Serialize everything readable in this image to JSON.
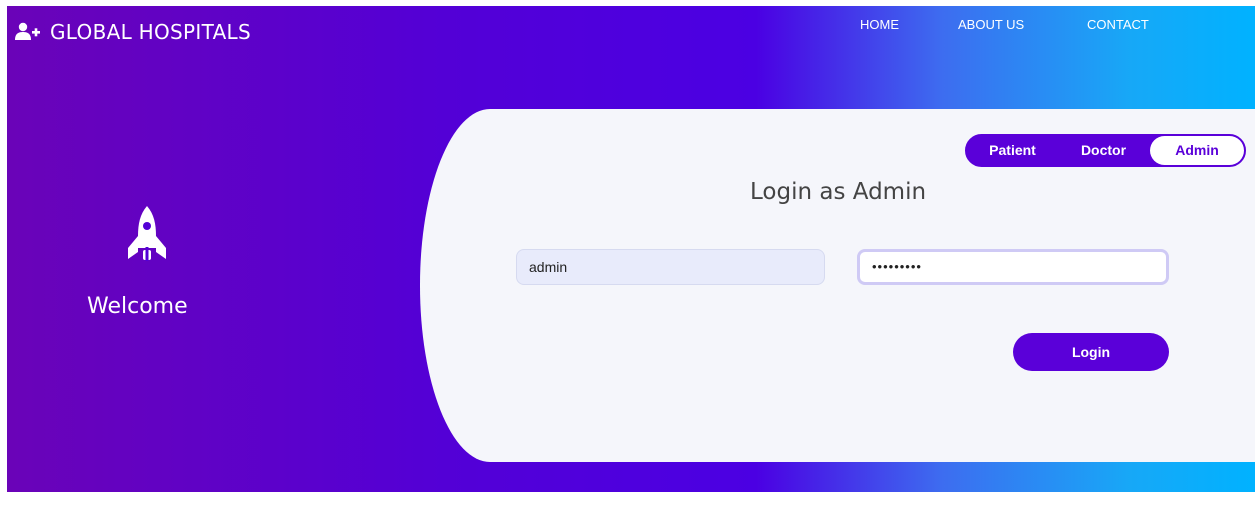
{
  "header": {
    "brand": "GLOBAL HOSPITALS",
    "brand_icon": "user-plus-icon",
    "nav": {
      "home": "HOME",
      "about": "ABOUT US",
      "contact": "CONTACT"
    }
  },
  "left_panel": {
    "icon": "rocket-icon",
    "welcome": "Welcome"
  },
  "login_card": {
    "roles": {
      "patient": "Patient",
      "doctor": "Doctor",
      "admin": "Admin"
    },
    "selected_role": "Admin",
    "title": "Login as Admin",
    "username_value": "admin",
    "password_mask": "•••••••••",
    "login_label": "Login"
  },
  "colors": {
    "accent": "#5a00d9",
    "gradient_start": "#6a03b8",
    "gradient_end": "#00b2ff",
    "card_bg": "#f5f6fb"
  }
}
